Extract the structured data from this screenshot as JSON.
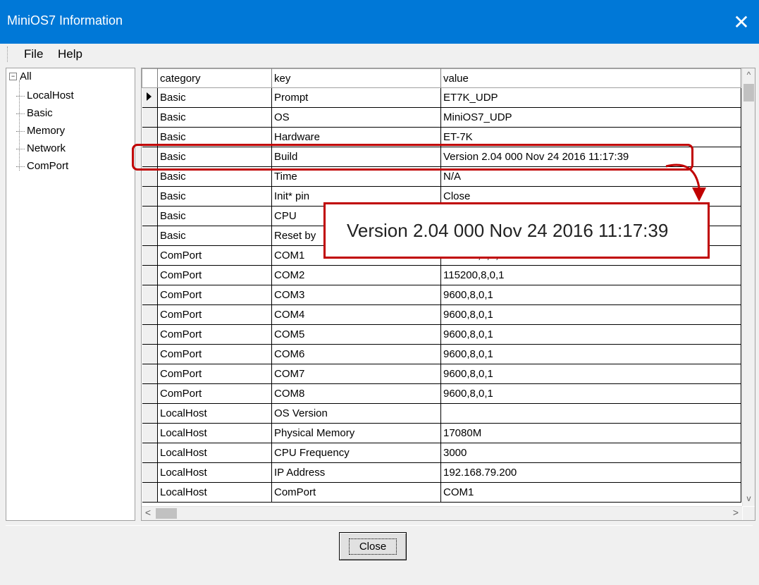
{
  "window": {
    "title": "MiniOS7 Information",
    "close_glyph": "✕"
  },
  "menu": {
    "file": "File",
    "help": "Help"
  },
  "tree": {
    "root_toggle": "−",
    "root": "All",
    "nodes": [
      "LocalHost",
      "Basic",
      "Memory",
      "Network",
      "ComPort"
    ]
  },
  "grid": {
    "headers": [
      "category",
      "key",
      "value"
    ],
    "rows": [
      [
        "Basic",
        "Prompt",
        "ET7K_UDP"
      ],
      [
        "Basic",
        "OS",
        "MiniOS7_UDP"
      ],
      [
        "Basic",
        "Hardware",
        "ET-7K"
      ],
      [
        "Basic",
        "Build",
        "Version 2.04 000 Nov 24 2016 11:17:39"
      ],
      [
        "Basic",
        "Time",
        "N/A"
      ],
      [
        "Basic",
        "Init* pin",
        "Close"
      ],
      [
        "Basic",
        "CPU",
        ""
      ],
      [
        "Basic",
        "Reset by",
        ""
      ],
      [
        "ComPort",
        "COM1",
        "115200,8,0,1"
      ],
      [
        "ComPort",
        "COM2",
        "115200,8,0,1"
      ],
      [
        "ComPort",
        "COM3",
        "9600,8,0,1"
      ],
      [
        "ComPort",
        "COM4",
        "9600,8,0,1"
      ],
      [
        "ComPort",
        "COM5",
        "9600,8,0,1"
      ],
      [
        "ComPort",
        "COM6",
        "9600,8,0,1"
      ],
      [
        "ComPort",
        "COM7",
        "9600,8,0,1"
      ],
      [
        "ComPort",
        "COM8",
        "9600,8,0,1"
      ],
      [
        "LocalHost",
        "OS Version",
        ""
      ],
      [
        "LocalHost",
        "Physical Memory",
        "17080M"
      ],
      [
        "LocalHost",
        "CPU Frequency",
        "3000"
      ],
      [
        "LocalHost",
        "IP Address",
        "192.168.79.200"
      ],
      [
        "LocalHost",
        "ComPort",
        "COM1"
      ]
    ],
    "scroll_up": "^",
    "scroll_down": "v",
    "scroll_left": "<",
    "scroll_right": ">"
  },
  "buttons": {
    "close": "Close"
  },
  "callout": {
    "text": "Version 2.04 000 Nov 24 2016 11:17:39"
  },
  "colors": {
    "titlebar": "#0078d7",
    "annotation": "#c00000"
  }
}
